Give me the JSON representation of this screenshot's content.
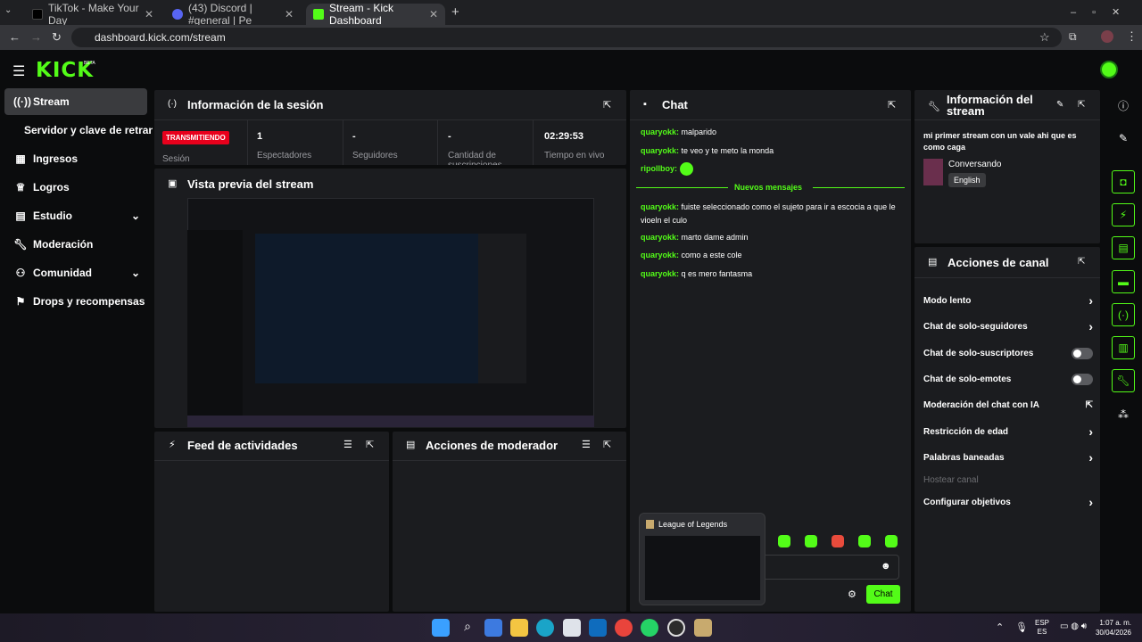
{
  "browser": {
    "tabs": [
      {
        "title": "TikTok - Make Your Day"
      },
      {
        "title": "(43) Discord | #general | Pe"
      },
      {
        "title": "Stream - Kick Dashboard"
      }
    ],
    "url": "dashboard.kick.com/stream",
    "new_tab": "+"
  },
  "kick": {
    "logo": "KICK",
    "beta": "BETA"
  },
  "sidebar": {
    "items": [
      {
        "label": "Stream"
      },
      {
        "label": "Servidor y clave de retransm"
      },
      {
        "label": "Ingresos"
      },
      {
        "label": "Logros"
      },
      {
        "label": "Estudio"
      },
      {
        "label": "Moderación"
      },
      {
        "label": "Comunidad"
      },
      {
        "label": "Drops y recompensas"
      }
    ]
  },
  "session": {
    "title": "Información de la sesión",
    "status": "TRANSMITIENDO",
    "status_label": "Sesión",
    "stats": [
      {
        "value": "1",
        "label": "Espectadores"
      },
      {
        "value": "-",
        "label": "Seguidores"
      },
      {
        "value": "-",
        "label": "Cantidad de suscripciones"
      },
      {
        "value": "02:29:53",
        "label": "Tiempo en vivo"
      }
    ]
  },
  "preview": {
    "title": "Vista previa del stream"
  },
  "feed": {
    "title": "Feed de actividades"
  },
  "modactions": {
    "title": "Acciones de moderador"
  },
  "chat": {
    "title": "Chat",
    "messages": [
      {
        "user": "quaryokk:",
        "text": "malparido"
      },
      {
        "user": "quaryokk:",
        "text": "te veo y te meto la monda"
      },
      {
        "user": "ripollboy:",
        "text": ""
      }
    ],
    "divider": "Nuevos mensajes",
    "new_messages": [
      {
        "user": "quaryokk:",
        "text": "fuiste seleccionado como el sujeto para ir a escocia a que le vioeln el culo"
      },
      {
        "user": "quaryokk:",
        "text": "marto dame admin"
      },
      {
        "user": "quaryokk:",
        "text": "como a este cole"
      },
      {
        "user": "quaryokk:",
        "text": "q es mero fantasma"
      }
    ],
    "send": "Chat",
    "popup": "League of Legends"
  },
  "streaminfo": {
    "title": "Información del stream",
    "description": "mi primer stream con un vale ahi que es como caga",
    "category": "Conversando",
    "language": "English"
  },
  "channel": {
    "title": "Acciones de canal",
    "actions": [
      {
        "label": "Modo lento"
      },
      {
        "label": "Chat de solo-seguidores"
      },
      {
        "label": "Chat de solo-suscriptores"
      },
      {
        "label": "Chat de solo-emotes"
      },
      {
        "label": "Moderación del chat con IA"
      },
      {
        "label": "Restricción de edad"
      },
      {
        "label": "Palabras baneadas"
      },
      {
        "label": "Hostear canal"
      },
      {
        "label": "Configurar objetivos"
      }
    ]
  },
  "taskbar": {
    "lang1": "ESP",
    "lang2": "ES",
    "time": "1:07 a. m.",
    "date": "30/04/2026"
  },
  "colors": {
    "accent": "#53fc18",
    "live": "#e8001c"
  }
}
